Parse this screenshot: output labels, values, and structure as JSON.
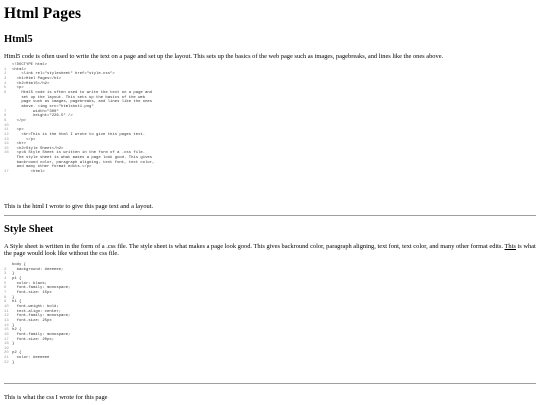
{
  "title": "Html Pages",
  "html_section": {
    "heading": "Html5",
    "intro": "Html5 code is often used to write the text on a page and set up the layout. This sets up the basics of the web page such as images, pagebreaks, and lines like the ones above.",
    "code_lines": [
      {
        "n": "",
        "text": "<!DOCTYPE html>"
      },
      {
        "n": "1",
        "text": "<html>"
      },
      {
        "n": "2",
        "text": "    <link rel=\"stylesheet\" href=\"style.css\">"
      },
      {
        "n": "3",
        "text": "  <h1>Html Pages</h1>"
      },
      {
        "n": "4",
        "text": "  <h2>Html5</h2>"
      },
      {
        "n": "5",
        "text": "  <p>"
      },
      {
        "n": "6",
        "text": "    Html5 code is often used to write the text on a page and"
      },
      {
        "n": "",
        "text": "    set up the layout. This sets up the basics of the web"
      },
      {
        "n": "",
        "text": "    page such as images, pagebreaks, and lines like the ones"
      },
      {
        "n": "",
        "text": "    above. <img src=\"htmlshot1.png\""
      },
      {
        "n": "7",
        "text": "         width=\"300\""
      },
      {
        "n": "8",
        "text": "         height=\"226.5\" />"
      },
      {
        "n": "9",
        "text": "  </p>"
      },
      {
        "n": "10",
        "text": ""
      },
      {
        "n": "11",
        "text": "  <p>"
      },
      {
        "n": "12",
        "text": "    <br>This is the html I wrote to give this pages text."
      },
      {
        "n": "13",
        "text": "      </p>"
      },
      {
        "n": "14",
        "text": "  <hr>"
      },
      {
        "n": "15",
        "text": "  <h2>Style Sheet</h2>"
      },
      {
        "n": "16",
        "text": "  <p>A Style Sheet is written in the form of a .css file."
      },
      {
        "n": "",
        "text": "  The style sheet is what makes a page look good. This gives"
      },
      {
        "n": "",
        "text": "  backround color, paragraph aligning, text font, text color,"
      },
      {
        "n": "",
        "text": "  and many other format edits.</p>"
      },
      {
        "n": "17",
        "text": "        <html>"
      }
    ],
    "caption": "This is the html I wrote to give this page text and a layout."
  },
  "css_section": {
    "heading": "Style Sheet",
    "paragraph": "A Style sheet is written in the form of a .css file. The style sheet is what makes a page look good. This gives backround color, paragraph aligning, text font, text color, and many other format edits.",
    "link_text": "This",
    "link_tail": " is what the page would look like without the css file.",
    "code_lines": [
      {
        "n": "",
        "text": "body {"
      },
      {
        "n": "2",
        "text": "  background: #eeeeee;"
      },
      {
        "n": "3",
        "text": "}"
      },
      {
        "n": "4",
        "text": "p1 {"
      },
      {
        "n": "5",
        "text": "  color: black;"
      },
      {
        "n": "6",
        "text": "  font-family: monospace;"
      },
      {
        "n": "7",
        "text": "  font-size: 15px"
      },
      {
        "n": "8",
        "text": "}"
      },
      {
        "n": "9",
        "text": "h1 {"
      },
      {
        "n": "10",
        "text": "  font-weight: bold;"
      },
      {
        "n": "11",
        "text": "  text-align: center;"
      },
      {
        "n": "12",
        "text": "  font-family: monospace;"
      },
      {
        "n": "13",
        "text": "  font-size: 25px"
      },
      {
        "n": "14",
        "text": "}"
      },
      {
        "n": "15",
        "text": "h2 {"
      },
      {
        "n": "16",
        "text": "  font-family: monospace;"
      },
      {
        "n": "17",
        "text": "  font-size: 20px;"
      },
      {
        "n": "18",
        "text": "}"
      },
      {
        "n": "19",
        "text": ""
      },
      {
        "n": "20",
        "text": "p2 {"
      },
      {
        "n": "21",
        "text": "  color: #eeeeee"
      },
      {
        "n": "22",
        "text": "}"
      }
    ],
    "caption": "This is what the css I wrote for this page"
  }
}
